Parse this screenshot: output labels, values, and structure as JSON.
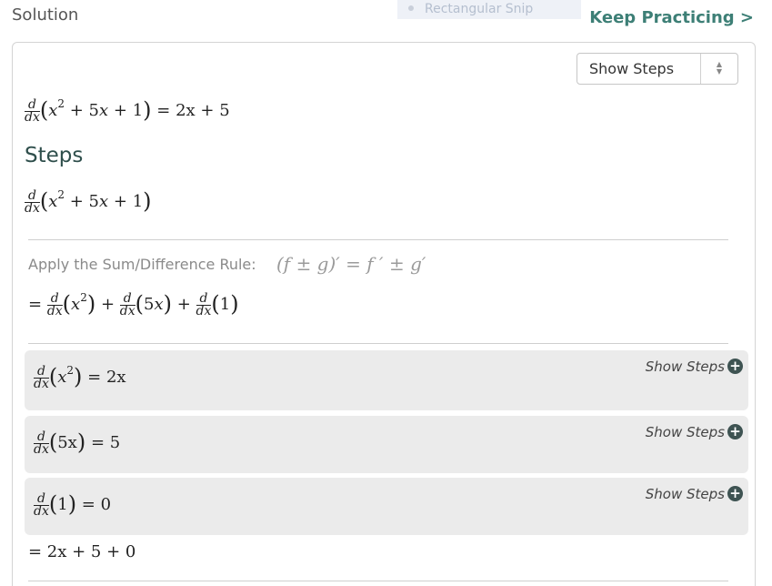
{
  "header": {
    "solution_label": "Solution",
    "snip_label": "Rectangular Snip",
    "keep_practicing": "Keep Practicing >"
  },
  "controls": {
    "show_steps_select": "Show Steps"
  },
  "solution": {
    "lhs_d": "d",
    "lhs_dx": "dx",
    "result_rhs": "= 2x + 5"
  },
  "steps": {
    "title": "Steps",
    "rule_label": "Apply the Sum/Difference Rule:",
    "rule_formula": "(f ± g)′ = f ′ ± g′",
    "final_line": "= 2x + 5 + 0"
  },
  "substeps": [
    {
      "expr": "x",
      "sup": "2",
      "result": "= 2x",
      "show_label": "Show Steps"
    },
    {
      "expr": "5x",
      "result": "= 5",
      "show_label": "Show Steps"
    },
    {
      "expr": "1",
      "result": "= 0",
      "show_label": "Show Steps"
    }
  ],
  "icons": {
    "plus": "plus-circle-icon",
    "select_arrows": "updown-arrows-icon"
  },
  "colors": {
    "accent": "#3d7f76",
    "substep_bg": "#ebebeb"
  }
}
